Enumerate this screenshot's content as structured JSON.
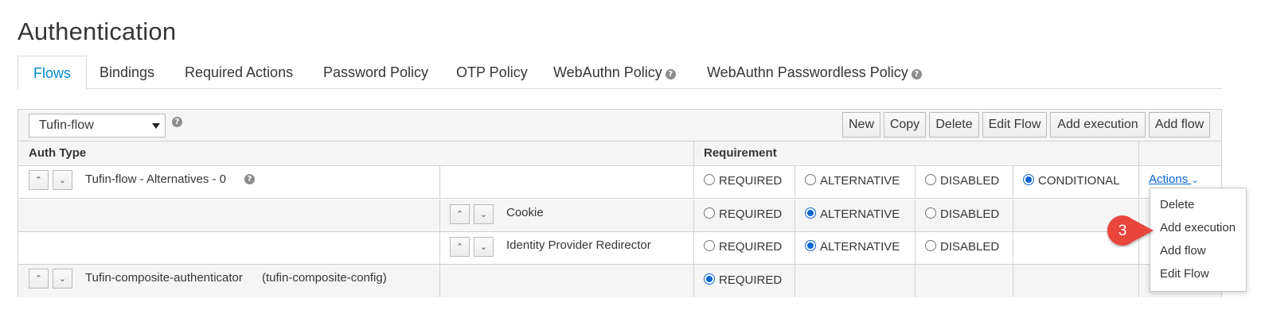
{
  "page": {
    "title": "Authentication"
  },
  "tabs": [
    {
      "label": "Flows",
      "active": true
    },
    {
      "label": "Bindings"
    },
    {
      "label": "Required Actions"
    },
    {
      "label": "Password Policy"
    },
    {
      "label": "OTP Policy"
    },
    {
      "label": "WebAuthn Policy",
      "help_icon": "question-circle-icon"
    },
    {
      "label": "WebAuthn Passwordless Policy",
      "help_icon": "question-circle-icon"
    }
  ],
  "toolbar": {
    "flow_select_value": "Tufin-flow",
    "buttons": [
      "New",
      "Copy",
      "Delete",
      "Edit Flow",
      "Add execution",
      "Add flow"
    ]
  },
  "table": {
    "headers": {
      "auth_type": "Auth Type",
      "requirement": "Requirement"
    },
    "rows": [
      {
        "name": "Tufin-flow - Alternatives - 0",
        "requirements": [
          {
            "label": "REQUIRED",
            "selected": false
          },
          {
            "label": "ALTERNATIVE",
            "selected": false
          },
          {
            "label": "DISABLED",
            "selected": false
          },
          {
            "label": "CONDITIONAL",
            "selected": true
          }
        ],
        "actions_label": "Actions"
      },
      {
        "name": "Cookie",
        "requirements": [
          {
            "label": "REQUIRED",
            "selected": false
          },
          {
            "label": "ALTERNATIVE",
            "selected": true
          },
          {
            "label": "DISABLED",
            "selected": false
          }
        ]
      },
      {
        "name": "Identity Provider Redirector",
        "requirements": [
          {
            "label": "REQUIRED",
            "selected": false
          },
          {
            "label": "ALTERNATIVE",
            "selected": true
          },
          {
            "label": "DISABLED",
            "selected": false
          }
        ]
      },
      {
        "name": "Tufin-composite-authenticator",
        "config": "(tufin-composite-config)",
        "requirements": [
          {
            "label": "REQUIRED",
            "selected": true
          }
        ]
      }
    ]
  },
  "actions_menu": {
    "items": [
      "Delete",
      "Add execution",
      "Add flow",
      "Edit Flow"
    ]
  },
  "callout": {
    "number": "3",
    "color": "#e8453c"
  },
  "colors": {
    "accent": "#0088ce",
    "link": "#0a66d4",
    "border": "#d1d1d1",
    "header_bg": "#f5f5f5"
  }
}
